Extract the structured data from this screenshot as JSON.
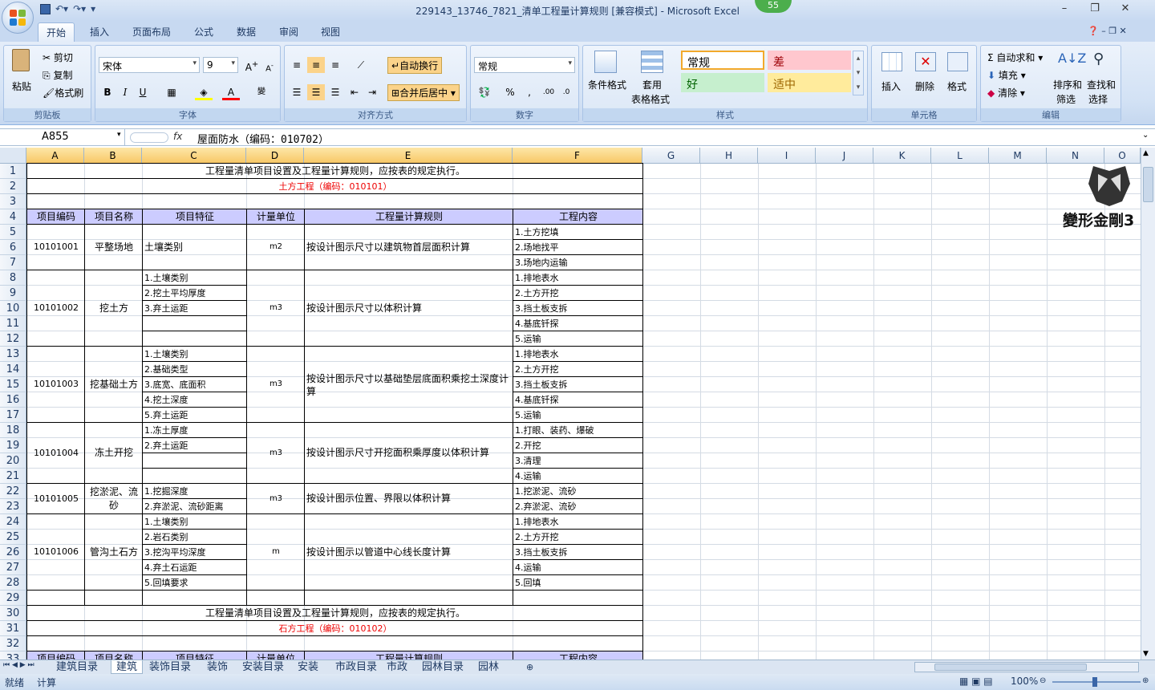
{
  "window": {
    "title": "229143_13746_7821_清单工程量计算规则  [兼容模式] - Microsoft Excel",
    "badge": "55"
  },
  "tabs": [
    "开始",
    "插入",
    "页面布局",
    "公式",
    "数据",
    "审阅",
    "视图"
  ],
  "ribbon": {
    "clipboard": {
      "label": "剪贴板",
      "paste": "粘贴",
      "cut": "剪切",
      "copy": "复制",
      "format_painter": "格式刷"
    },
    "font": {
      "label": "字体",
      "name": "宋体",
      "size": "9"
    },
    "alignment": {
      "label": "对齐方式",
      "wrap": "自动换行",
      "merge": "合并后居中"
    },
    "number": {
      "label": "数字",
      "format": "常规"
    },
    "styles": {
      "label": "样式",
      "conditional": "条件格式",
      "table": "套用",
      "table2": "表格格式",
      "normal": "常规",
      "bad": "差",
      "good": "好",
      "neutral": "适中"
    },
    "cells": {
      "label": "单元格",
      "insert": "插入",
      "delete": "删除",
      "format": "格式"
    },
    "editing": {
      "label": "编辑",
      "autosum": "自动求和",
      "fill": "填充",
      "clear": "清除",
      "sort": "排序和",
      "sort2": "筛选",
      "find": "查找和",
      "find2": "选择"
    }
  },
  "formula": {
    "namebox": "A855",
    "fx": "fx",
    "content": "屋面防水（编码：010702）"
  },
  "columns": [
    "A",
    "B",
    "C",
    "D",
    "E",
    "F",
    "G",
    "H",
    "I",
    "J",
    "K",
    "L",
    "M",
    "N",
    "O"
  ],
  "rows": [
    "1",
    "2",
    "3",
    "4",
    "5",
    "6",
    "7",
    "8",
    "9",
    "10",
    "11",
    "12",
    "13",
    "14",
    "15",
    "16",
    "17",
    "18",
    "19",
    "20",
    "21",
    "22",
    "23",
    "24",
    "25",
    "26",
    "27",
    "28",
    "29",
    "30",
    "31",
    "32",
    "33"
  ],
  "sheet": {
    "title1": "工程量清单项目设置及工程量计算规则，应按表的规定执行。",
    "section1": "土方工程（编码：010101）",
    "headers": [
      "项目编码",
      "项目名称",
      "项目特征",
      "计量单位",
      "工程量计算规则",
      "工程内容"
    ],
    "items": [
      {
        "code": "10101001",
        "name": "平整场地",
        "unit": "m2",
        "rule": "按设计图示尺寸以建筑物首层面积计算",
        "features": [
          "土壤类别"
        ],
        "content": [
          "1.土方挖填",
          "2.场地找平",
          "3.场地内运输"
        ]
      },
      {
        "code": "10101002",
        "name": "挖土方",
        "unit": "m3",
        "rule": "按设计图示尺寸以体积计算",
        "features": [
          "1.土壤类别",
          "2.挖土平均厚度",
          "3.弃土运距",
          "",
          ""
        ],
        "content": [
          "1.排地表水",
          "2.土方开挖",
          "3.挡土板支拆",
          "4.基底钎探",
          "5.运输"
        ]
      },
      {
        "code": "10101003",
        "name": "挖基础土方",
        "unit": "m3",
        "rule1": "按设计图示尺寸以基础垫层底面积乘挖土深度计",
        "rule2": "算",
        "features": [
          "1.土壤类别",
          "2.基础类型",
          "3.底宽、底面积",
          "4.挖土深度",
          "5.弃土运距"
        ],
        "content": [
          "1.排地表水",
          "2.土方开挖",
          "3.挡土板支拆",
          "4.基底钎探",
          "5.运输"
        ]
      },
      {
        "code": "10101004",
        "name": "冻土开挖",
        "unit": "m3",
        "rule": "按设计图示尺寸开挖面积乘厚度以体积计算",
        "features": [
          "1.冻土厚度",
          "2.弃土运距",
          "",
          ""
        ],
        "content": [
          "1.打眼、装药、爆破",
          "2.开挖",
          "3.清理",
          "4.运输"
        ]
      },
      {
        "code": "10101005",
        "name1": "挖淤泥、流",
        "name2": "砂",
        "unit": "m3",
        "rule": "按设计图示位置、界限以体积计算",
        "features": [
          "1.挖掘深度",
          "2.弃淤泥、流砂距离"
        ],
        "content": [
          "1.挖淤泥、流砂",
          "2.弃淤泥、流砂"
        ]
      },
      {
        "code": "10101006",
        "name": "管沟土石方",
        "unit": "m",
        "rule": "按设计图示以管道中心线长度计算",
        "features": [
          "1.土壤类别",
          "2.岩石类别",
          "3.挖沟平均深度",
          "4.弃土石运距",
          "5.回填要求"
        ],
        "content": [
          "1.排地表水",
          "2.土方开挖",
          "3.挡土板支拆",
          "4.运输",
          "5.回填"
        ]
      }
    ],
    "title2": "工程量清单项目设置及工程量计算规则，应按表的规定执行。",
    "section2": "石方工程（编码：010102）",
    "headers2": [
      "项目编码",
      "项目名称",
      "项目特征",
      "计量单位",
      "工程量计算规则",
      "工程内容"
    ]
  },
  "logo_text": "變形金剛3",
  "sheet_tabs": [
    "建筑目录",
    "建筑",
    "装饰目录",
    "装饰",
    "安装目录",
    "安装",
    "市政目录",
    "市政",
    "园林目录",
    "园林"
  ],
  "status": {
    "ready": "就绪",
    "calc": "计算",
    "zoom": "100%"
  }
}
